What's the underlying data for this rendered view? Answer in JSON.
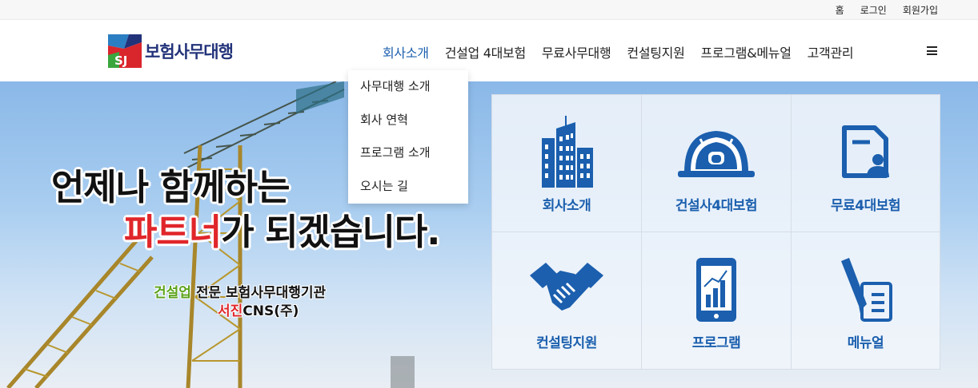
{
  "topbar": {
    "links": [
      {
        "label": "홈"
      },
      {
        "label": "로그인"
      },
      {
        "label": "회원가입"
      }
    ]
  },
  "logo": {
    "mark_text": "SJ",
    "name": "보험사무대행"
  },
  "nav": {
    "items": [
      {
        "label": "회사소개"
      },
      {
        "label": "건설업 4대보험"
      },
      {
        "label": "무료사무대행"
      },
      {
        "label": "컨설팅지원"
      },
      {
        "label": "프로그램&메뉴얼"
      },
      {
        "label": "고객관리"
      }
    ],
    "menu_icon": "hamburger-icon"
  },
  "dropdown": {
    "items": [
      {
        "label": "사무대행 소개"
      },
      {
        "label": "회사 연혁"
      },
      {
        "label": "프로그램 소개"
      },
      {
        "label": "오시는 길"
      }
    ]
  },
  "hero": {
    "headline1": "언제나 함께하는",
    "headline2_red": "파트너",
    "headline2_rest": "가 되겠습니다.",
    "sub1_green": "건설업",
    "sub1_rest": " 전문 보험사무대행기관",
    "sub2_red": "서진",
    "sub2_rest": "CNS(주)"
  },
  "tiles": [
    {
      "label": "회사소개",
      "icon": "building-icon"
    },
    {
      "label": "건설사4대보험",
      "icon": "hardhat-icon"
    },
    {
      "label": "무료4대보험",
      "icon": "document-user-icon"
    },
    {
      "label": "컨설팅지원",
      "icon": "handshake-icon"
    },
    {
      "label": "프로그램",
      "icon": "mobile-chart-icon"
    },
    {
      "label": "메뉴얼",
      "icon": "pen-document-icon"
    }
  ],
  "colors": {
    "brand_blue": "#1b5fae",
    "logo_navy": "#23337a",
    "accent_red": "#e0262a",
    "accent_green": "#5ba21b"
  }
}
